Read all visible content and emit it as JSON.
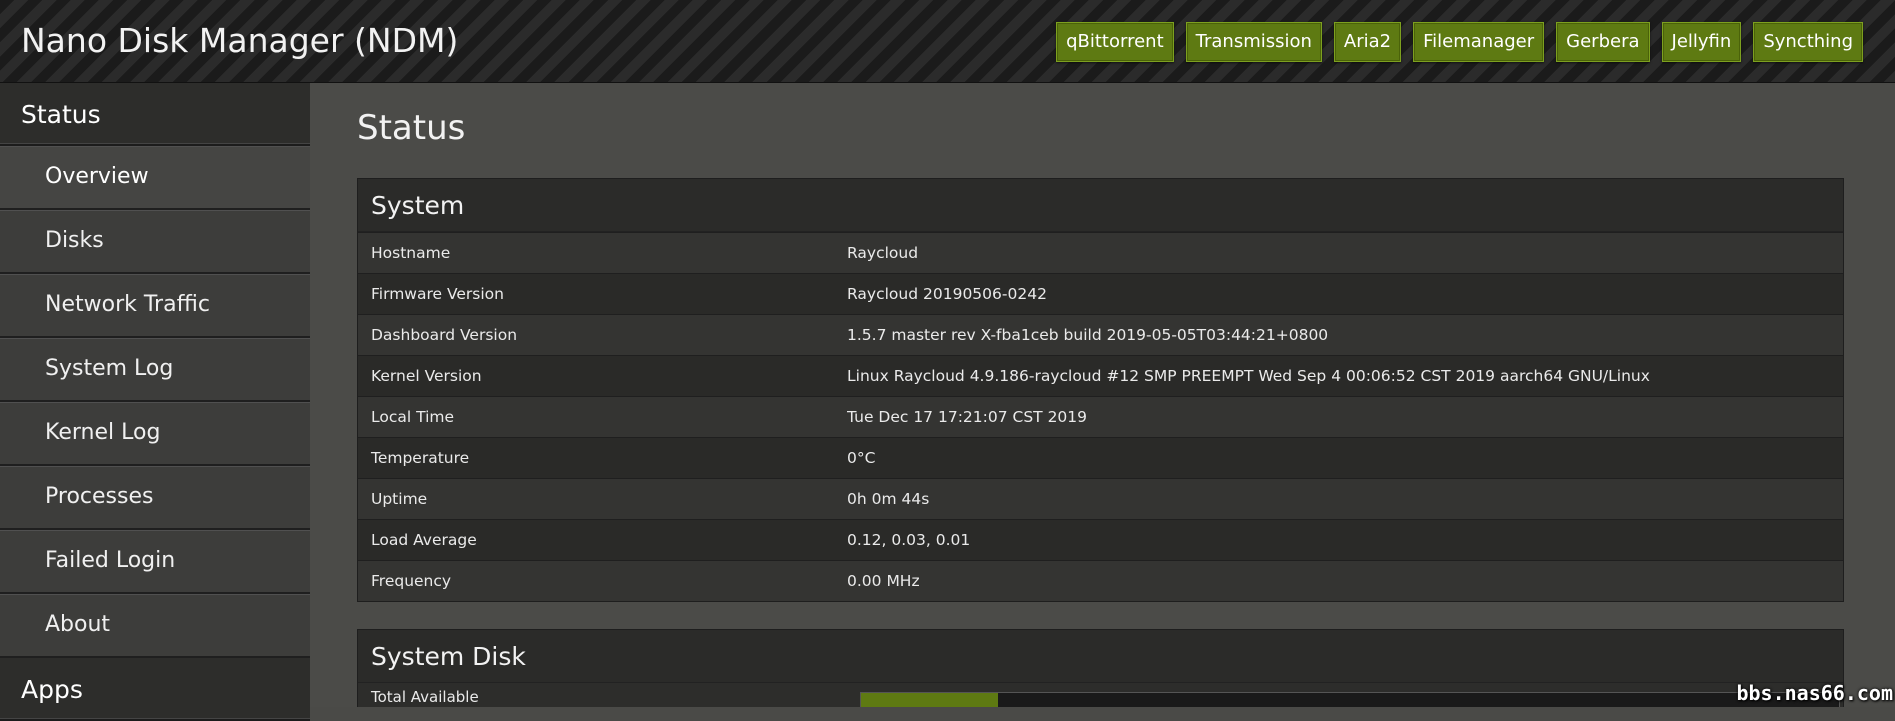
{
  "header": {
    "title": "Nano Disk Manager (NDM)",
    "apps": [
      "qBittorrent",
      "Transmission",
      "Aria2",
      "Filemanager",
      "Gerbera",
      "Jellyfin",
      "Syncthing"
    ]
  },
  "sidebar": {
    "section_status": "Status",
    "items": [
      "Overview",
      "Disks",
      "Network Traffic",
      "System Log",
      "Kernel Log",
      "Processes",
      "Failed Login",
      "About"
    ],
    "active_item": "Overview",
    "section_apps": "Apps"
  },
  "main": {
    "page_title": "Status",
    "system": {
      "title": "System",
      "rows": [
        {
          "key": "Hostname",
          "value": "Raycloud"
        },
        {
          "key": "Firmware Version",
          "value": "Raycloud 20190506-0242"
        },
        {
          "key": "Dashboard Version",
          "value": "1.5.7 master rev X-fba1ceb build 2019-05-05T03:44:21+0800"
        },
        {
          "key": "Kernel Version",
          "value": "Linux Raycloud 4.9.186-raycloud #12 SMP PREEMPT Wed Sep 4 00:06:52 CST 2019 aarch64 GNU/Linux"
        },
        {
          "key": "Local Time",
          "value": "Tue Dec 17 17:21:07 CST 2019"
        },
        {
          "key": "Temperature",
          "value": "0°C"
        },
        {
          "key": "Uptime",
          "value": "0h 0m 44s"
        },
        {
          "key": "Load Average",
          "value": "0.12, 0.03, 0.01"
        },
        {
          "key": "Frequency",
          "value": "0.00 MHz"
        }
      ]
    },
    "system_disk": {
      "title": "System Disk",
      "row_key": "Total Available",
      "usage_fraction": 0.14
    }
  },
  "watermark": "bbs.nas66.com",
  "colors": {
    "accent_green": "#5e7a12",
    "background": "#4b4b48"
  }
}
